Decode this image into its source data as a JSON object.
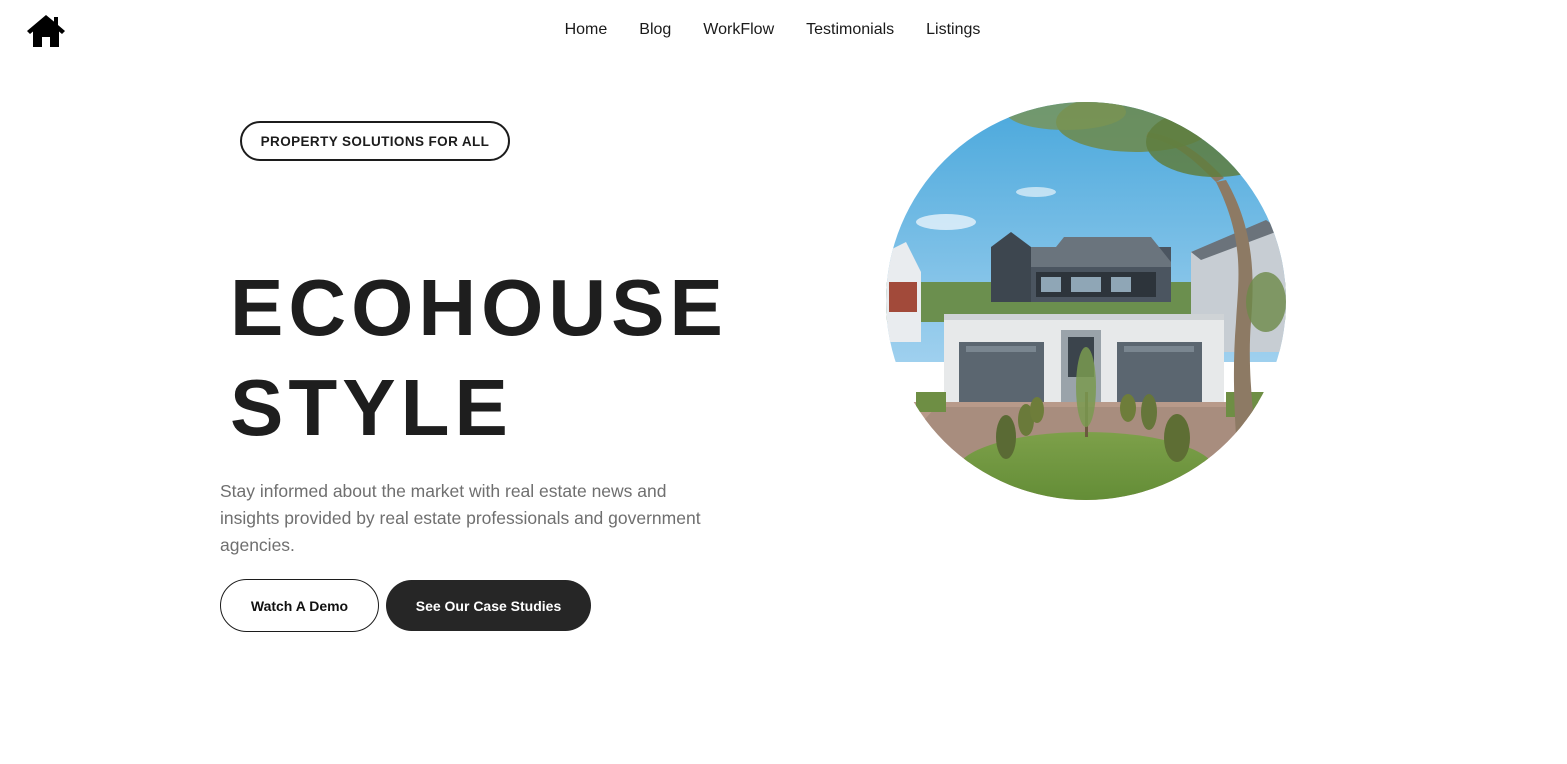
{
  "header": {
    "logo_icon": "home-icon",
    "nav": [
      {
        "label": "Home"
      },
      {
        "label": "Blog"
      },
      {
        "label": "WorkFlow"
      },
      {
        "label": "Testimonials"
      },
      {
        "label": "Listings"
      }
    ]
  },
  "hero": {
    "badge": "PROPERTY SOLUTIONS FOR ALL",
    "headline_line1": "ECOHOUSE",
    "headline_line2": "STYLE",
    "description": "Stay informed about the market with real estate news and insights provided by real estate professionals and government agencies.",
    "buttons": {
      "demo_label": "Watch A Demo",
      "case_label": "See Our Case Studies"
    },
    "image_icon": "house-photo"
  },
  "colors": {
    "text_dark": "#1c1c1c",
    "text_muted": "#6f6f6f",
    "button_dark": "#262626",
    "background": "#ffffff"
  }
}
